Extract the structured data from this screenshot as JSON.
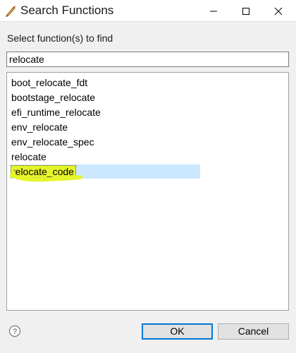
{
  "window": {
    "title": "Search Functions",
    "icon": "quill-icon"
  },
  "controls": {
    "minimize_icon": "minimize-icon",
    "maximize_icon": "maximize-icon",
    "close_icon": "close-icon"
  },
  "prompt": "Select function(s) to find",
  "search": {
    "value": "relocate",
    "placeholder": ""
  },
  "results": {
    "items": [
      {
        "label": "boot_relocate_fdt",
        "selected": false
      },
      {
        "label": "bootstage_relocate",
        "selected": false
      },
      {
        "label": "efi_runtime_relocate",
        "selected": false
      },
      {
        "label": "env_relocate",
        "selected": false
      },
      {
        "label": "env_relocate_spec",
        "selected": false
      },
      {
        "label": "relocate",
        "selected": false
      },
      {
        "label": "relocate_code",
        "selected": true
      }
    ],
    "selection_color": "#cce8ff",
    "highlight_color": "#e6f52a"
  },
  "footer": {
    "help_icon": "help-icon",
    "ok_label": "OK",
    "cancel_label": "Cancel"
  },
  "colors": {
    "accent": "#0078d7"
  }
}
